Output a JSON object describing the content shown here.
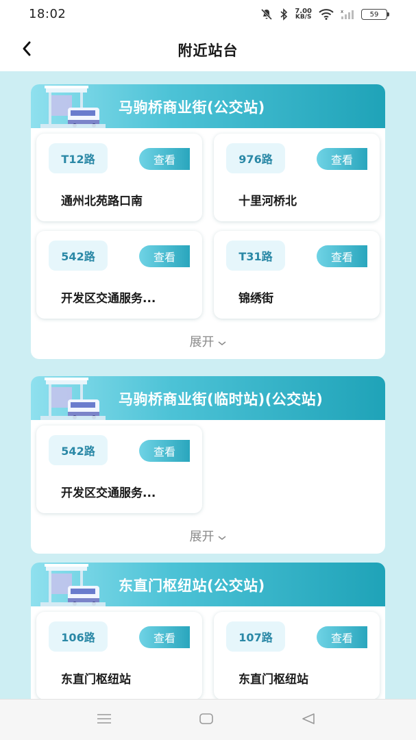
{
  "status_bar": {
    "time": "18:02",
    "net_speed_value": "7.00",
    "net_speed_unit": "KB/S",
    "battery": "59",
    "icons": [
      "mute-icon",
      "bluetooth-icon",
      "wifi-icon",
      "signal-icon",
      "battery-icon"
    ]
  },
  "header": {
    "back_icon": "chevron-left-icon",
    "title": "附近站台"
  },
  "colors": {
    "background": "#cdeef3",
    "header_gradient_start": "#8fe0ee",
    "header_gradient_end": "#1fa3b8",
    "route_text": "#2a88a6",
    "badge_bg": "#e6f6fb"
  },
  "stations": [
    {
      "name": "马驹桥商业街(公交站)",
      "routes": [
        {
          "route": "T12路",
          "view": "查看",
          "stop": "通州北苑路口南"
        },
        {
          "route": "976路",
          "view": "查看",
          "stop": "十里河桥北"
        },
        {
          "route": "542路",
          "view": "查看",
          "stop": "开发区交通服务..."
        },
        {
          "route": "T31路",
          "view": "查看",
          "stop": "锦绣街"
        }
      ],
      "expand_label": "展开"
    },
    {
      "name": "马驹桥商业街(临时站)(公交站)",
      "routes": [
        {
          "route": "542路",
          "view": "查看",
          "stop": "开发区交通服务..."
        }
      ],
      "expand_label": "展开"
    },
    {
      "name": "东直门枢纽站(公交站)",
      "routes": [
        {
          "route": "106路",
          "view": "查看",
          "stop": "东直门枢纽站"
        },
        {
          "route": "107路",
          "view": "查看",
          "stop": "东直门枢纽站"
        }
      ]
    }
  ],
  "system_nav": {
    "icons": [
      "menu-icon",
      "home-icon",
      "back-triangle-icon"
    ]
  }
}
